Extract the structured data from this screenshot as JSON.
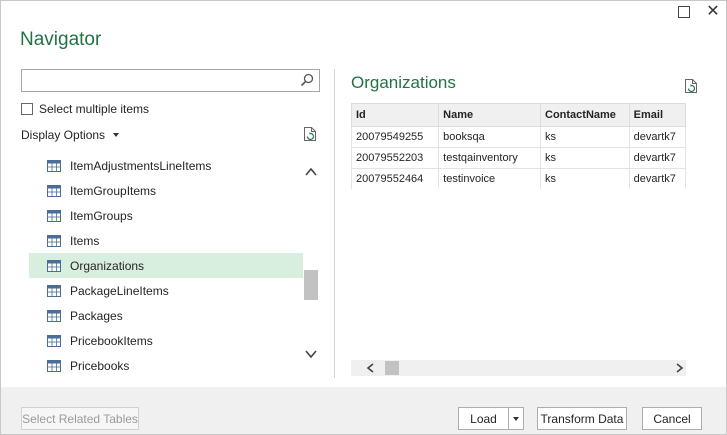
{
  "window": {
    "title": "Navigator",
    "maximize_icon": "maximize-icon",
    "close_label": "✕"
  },
  "left": {
    "search": {
      "value": "",
      "placeholder": ""
    },
    "select_multiple_label": "Select multiple items",
    "select_multiple_checked": false,
    "display_options_label": "Display Options",
    "items": [
      {
        "label": "ItemAdjustmentsLineItems",
        "selected": false
      },
      {
        "label": "ItemGroupItems",
        "selected": false
      },
      {
        "label": "ItemGroups",
        "selected": false
      },
      {
        "label": "Items",
        "selected": false
      },
      {
        "label": "Organizations",
        "selected": true
      },
      {
        "label": "PackageLineItems",
        "selected": false
      },
      {
        "label": "Packages",
        "selected": false
      },
      {
        "label": "PricebookItems",
        "selected": false
      },
      {
        "label": "Pricebooks",
        "selected": false
      }
    ]
  },
  "preview": {
    "title": "Organizations",
    "columns": [
      "Id",
      "Name",
      "ContactName",
      "Email"
    ],
    "rows": [
      [
        "20079549255",
        "booksqa",
        "ks",
        "devartk7"
      ],
      [
        "20079552203",
        "testqainventory",
        "ks",
        "devartk7"
      ],
      [
        "20079552464",
        "testinvoice",
        "ks",
        "devartk7"
      ]
    ]
  },
  "footer": {
    "select_related": "Select Related Tables",
    "load": "Load",
    "transform": "Transform Data",
    "cancel": "Cancel"
  },
  "colors": {
    "accent": "#217346",
    "selected_bg": "#d8eedf",
    "footer_bg": "#f0f0f0"
  }
}
